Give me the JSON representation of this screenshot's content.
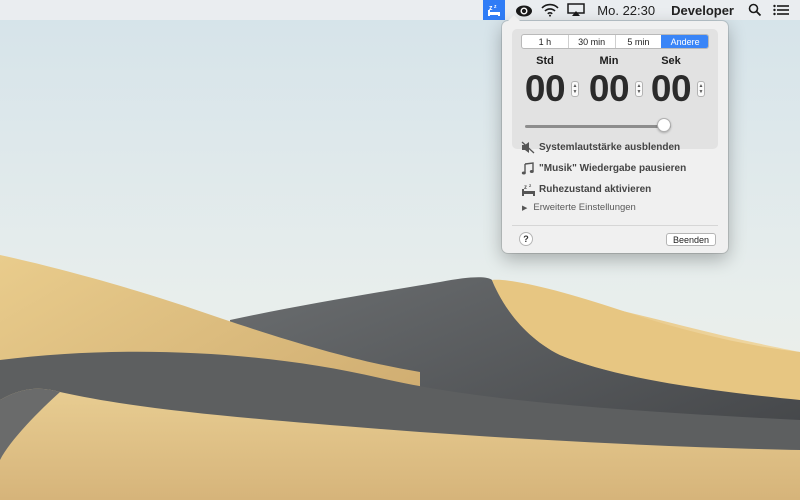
{
  "menubar": {
    "clock": "Mo. 22:30",
    "user": "Developer",
    "icons": [
      "sleep-timer-icon",
      "creative-cloud-icon",
      "wifi-icon",
      "airplay-icon",
      "search-icon",
      "control-center-icon"
    ]
  },
  "popover": {
    "presets": [
      {
        "label": "1 h",
        "selected": false
      },
      {
        "label": "30 min",
        "selected": false
      },
      {
        "label": "5 min",
        "selected": false
      },
      {
        "label": "Andere",
        "selected": true
      }
    ],
    "columns": {
      "hours": {
        "label": "Std",
        "value": "00"
      },
      "minutes": {
        "label": "Min",
        "value": "00"
      },
      "seconds": {
        "label": "Sek",
        "value": "00"
      }
    },
    "slider_level": 0.95,
    "options": {
      "mute": "Systemlautstärke ausblenden",
      "pause_music": "\"Musik\" Wiedergabe pausieren",
      "sleep": "Ruhezustand aktivieren"
    },
    "advanced": "Erweiterte Einstellungen",
    "help": "?",
    "quit": "Beenden"
  },
  "colors": {
    "accent": "#2f7cf6",
    "sky": "#dce8ed",
    "sand": "#e6c78a",
    "shadow_dune": "#4d4f52"
  }
}
